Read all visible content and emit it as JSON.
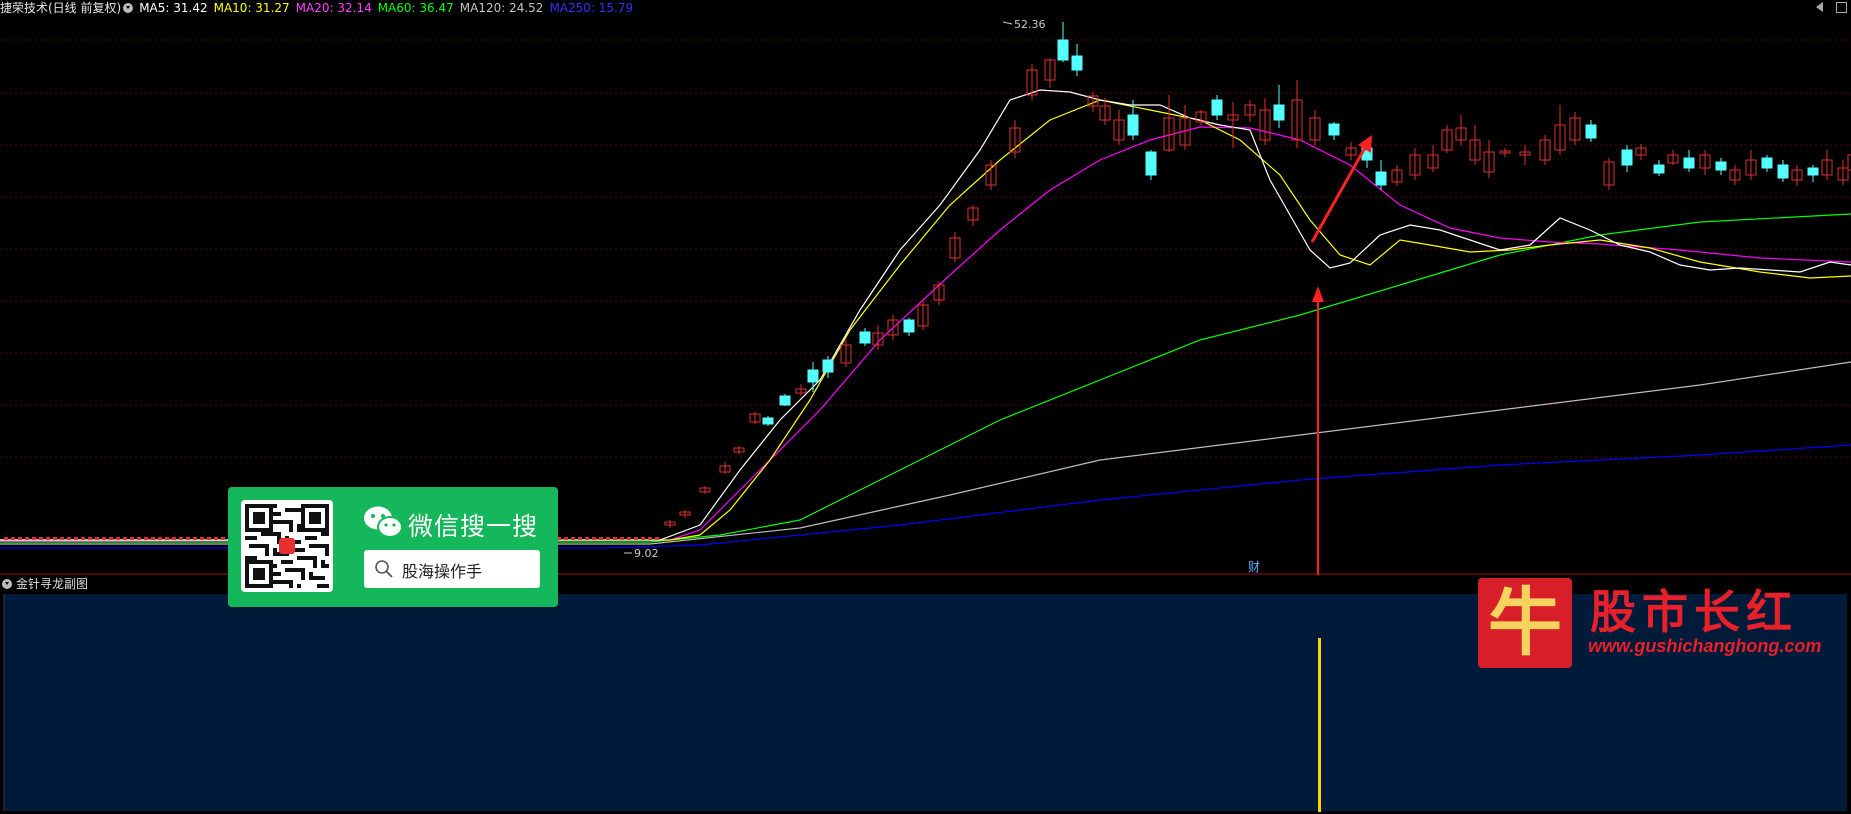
{
  "header": {
    "stock_title": "捷荣技术(日线 前复权)",
    "ma": [
      {
        "label": "MA5: 31.42",
        "color": "#ffffff"
      },
      {
        "label": "MA10: 31.27",
        "color": "#ffff00"
      },
      {
        "label": "MA20: 32.14",
        "color": "#ff00ff"
      },
      {
        "label": "MA60: 36.47",
        "color": "#00ff00"
      },
      {
        "label": "MA120: 24.52",
        "color": "#c0c0c0"
      },
      {
        "label": "MA250: 15.79",
        "color": "#0000ff"
      }
    ]
  },
  "chart": {
    "high_label": "52.36",
    "low_label": "9.02",
    "finance_marker": "财",
    "up_color": "#e03030",
    "down_color": "#54ffff"
  },
  "sub_panel": {
    "title": "金针寻龙副图",
    "bg_color": "#001a3a",
    "signal_color": "#ffd000"
  },
  "wechat": {
    "title": "微信搜一搜",
    "search_text": "股海操作手"
  },
  "brand": {
    "logo_char": "牛",
    "name": "股市长红",
    "url": "www.gushichanghong.com"
  }
}
